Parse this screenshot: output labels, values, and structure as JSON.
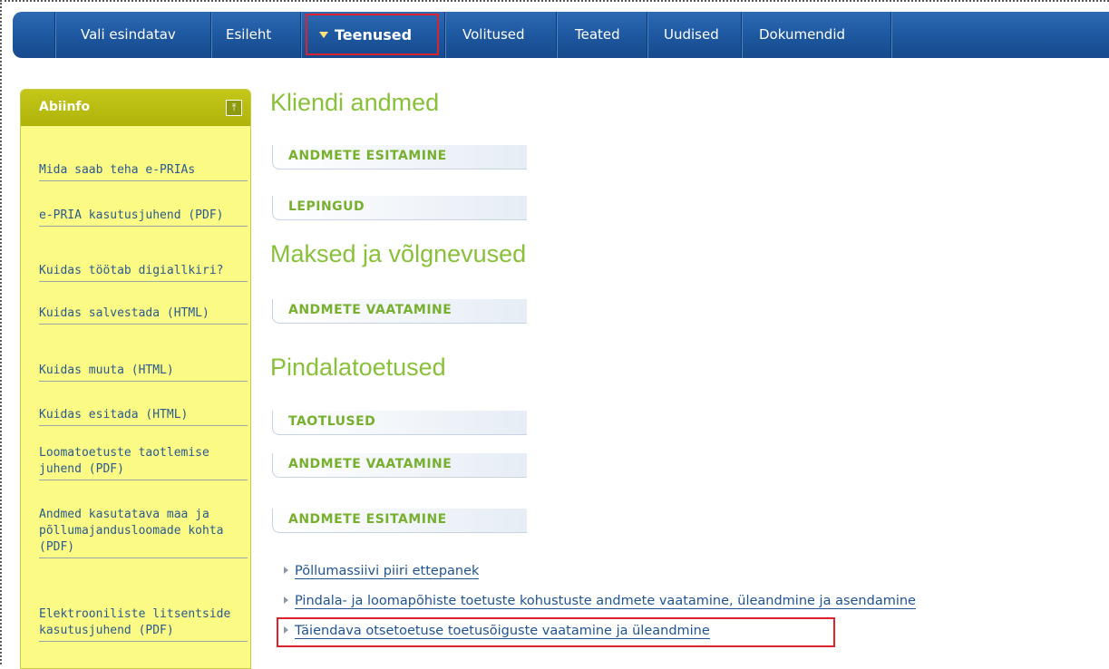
{
  "nav": {
    "items": [
      "Vali esindatav",
      "Esileht",
      "Teenused",
      "Volitused",
      "Teated",
      "Uudised",
      "Dokumendid"
    ]
  },
  "sidebar": {
    "title": "Abiinfo",
    "collapse_icon": "collapse-icon",
    "links": [
      "Mida saab teha e-PRIAs",
      "e-PRIA kasutusjuhend (PDF)",
      "Kuidas töötab digiallkiri?",
      "Kuidas salvestada (HTML)",
      "Kuidas muuta (HTML)",
      "Kuidas esitada (HTML)",
      "Loomatoetuste taotlemise juhend (PDF)",
      "Andmed kasutatava maa ja põllumajandusloomade kohta (PDF)",
      "Elektrooniliste litsentside kasutusjuhend (PDF)"
    ]
  },
  "main": {
    "groups": [
      {
        "title": "Kliendi andmed",
        "sections": [
          "ANDMETE ESITAMINE",
          "LEPINGUD"
        ]
      },
      {
        "title": "Maksed ja võlgnevused",
        "sections": [
          "ANDMETE VAATAMINE"
        ]
      },
      {
        "title": "Pindalatoetused",
        "sections": [
          "TAOTLUSED",
          "ANDMETE VAATAMINE",
          "ANDMETE ESITAMINE"
        ]
      }
    ],
    "links": [
      "Põllumassiivi piiri ettepanek",
      "Pindala- ja loomapõhiste toetuste kohustuste andmete vaatamine, üleandmine ja asendamine",
      "Täiendava otsetoetuse toetusõiguste vaatamine ja üleandmine"
    ]
  },
  "colors": {
    "nav_blue": "#1f5aa3",
    "accent_green": "#88c03a",
    "sidebar_yellow": "#fafa85",
    "highlight_red": "#d9232e"
  }
}
